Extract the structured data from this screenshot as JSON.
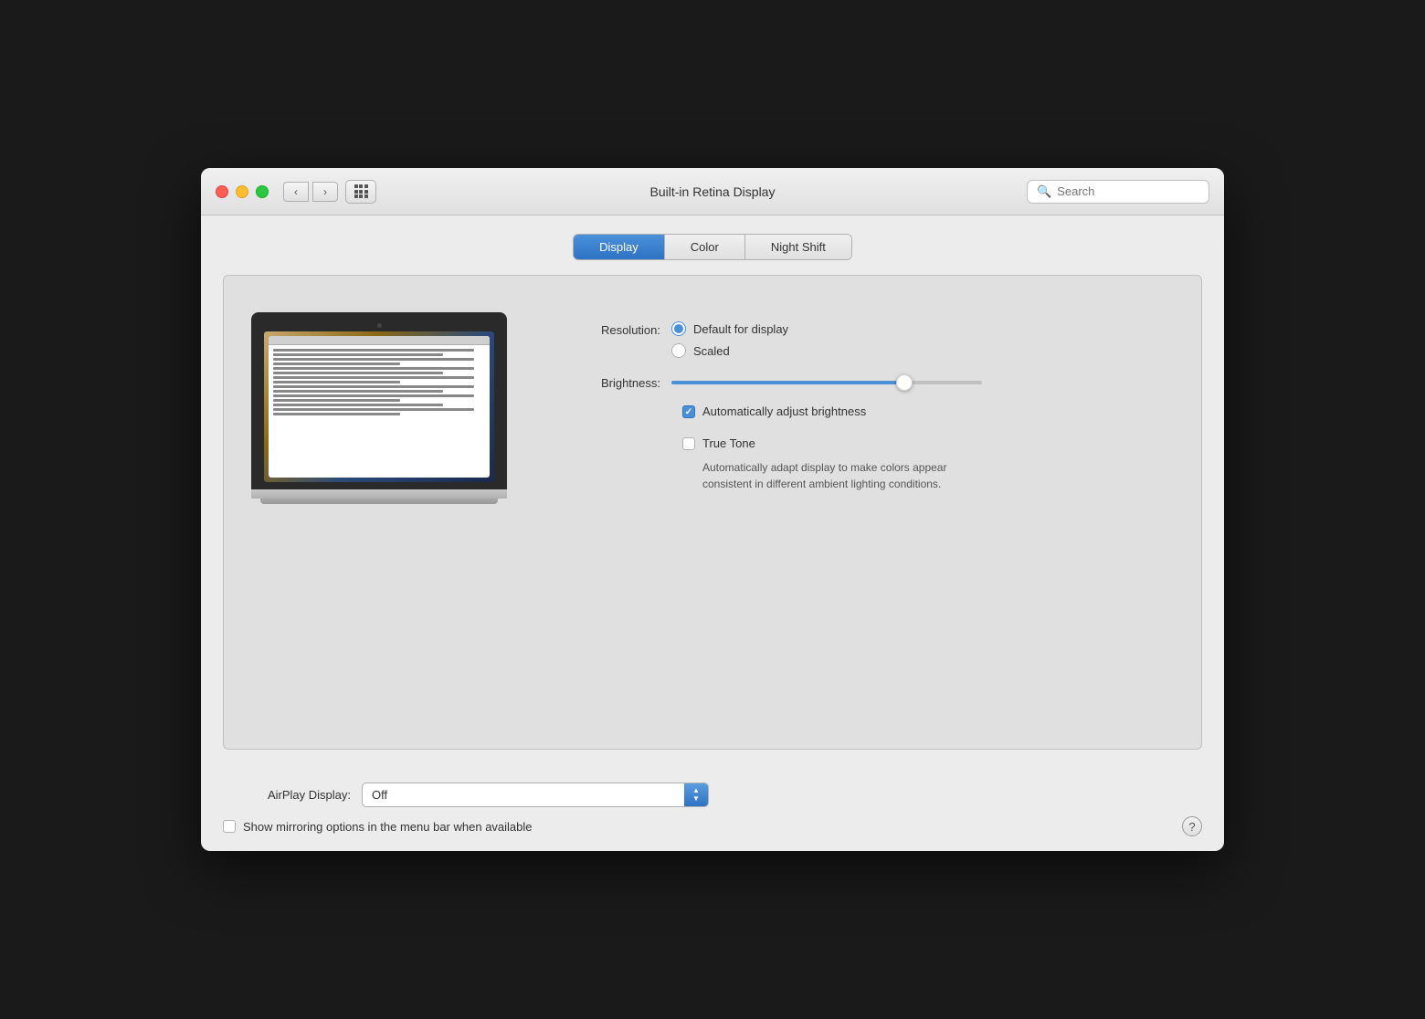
{
  "window": {
    "title": "Built-in Retina Display"
  },
  "titlebar": {
    "back_label": "‹",
    "forward_label": "›"
  },
  "search": {
    "placeholder": "Search"
  },
  "tabs": [
    {
      "id": "display",
      "label": "Display",
      "active": true
    },
    {
      "id": "color",
      "label": "Color",
      "active": false
    },
    {
      "id": "night_shift",
      "label": "Night Shift",
      "active": false
    }
  ],
  "resolution": {
    "label": "Resolution:",
    "options": [
      {
        "id": "default",
        "label": "Default for display",
        "selected": true
      },
      {
        "id": "scaled",
        "label": "Scaled",
        "selected": false
      }
    ]
  },
  "brightness": {
    "label": "Brightness:",
    "value": 75
  },
  "auto_brightness": {
    "label": "Automatically adjust brightness",
    "checked": true
  },
  "true_tone": {
    "label": "True Tone",
    "checked": false,
    "description": "Automatically adapt display to make colors appear consistent in different ambient lighting conditions."
  },
  "airplay": {
    "label": "AirPlay Display:",
    "value": "Off"
  },
  "mirroring": {
    "label": "Show mirroring options in the menu bar when available",
    "checked": false
  },
  "help": {
    "label": "?"
  }
}
